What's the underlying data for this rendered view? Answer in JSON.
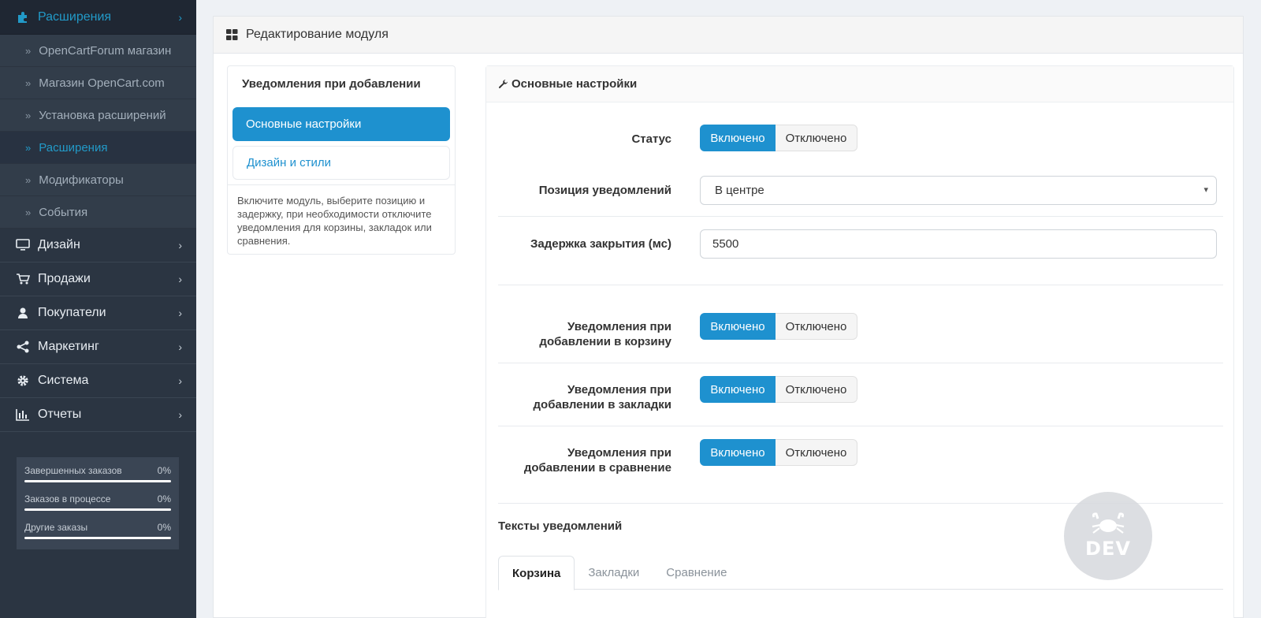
{
  "sidebar": {
    "top_item": {
      "label": "Расширения",
      "icon": "puzzle-icon"
    },
    "sub_items": [
      {
        "label": "OpenCartForum магазин",
        "active": false
      },
      {
        "label": "Магазин OpenCart.com",
        "active": false
      },
      {
        "label": "Установка расширений",
        "active": false
      },
      {
        "label": "Расширения",
        "active": true
      },
      {
        "label": "Модификаторы",
        "active": false
      },
      {
        "label": "События",
        "active": false
      }
    ],
    "items": [
      {
        "label": "Дизайн",
        "icon": "monitor-icon"
      },
      {
        "label": "Продажи",
        "icon": "cart-icon"
      },
      {
        "label": "Покупатели",
        "icon": "user-icon"
      },
      {
        "label": "Маркетинг",
        "icon": "share-icon"
      },
      {
        "label": "Система",
        "icon": "gear-icon"
      },
      {
        "label": "Отчеты",
        "icon": "bar-chart-icon"
      }
    ],
    "stats": [
      {
        "label": "Завершенных заказов",
        "value": "0%"
      },
      {
        "label": "Заказов в процессе",
        "value": "0%"
      },
      {
        "label": "Другие заказы",
        "value": "0%"
      }
    ]
  },
  "panel": {
    "title": "Редактирование модуля",
    "icon": "grid-icon"
  },
  "left_menu": {
    "title": "Уведомления при добавлении",
    "items": [
      {
        "label": "Основные настройки",
        "active": true
      },
      {
        "label": "Дизайн и стили",
        "active": false
      }
    ],
    "description": "Включите модуль, выберите позицию и задержку, при необходимости отключите уведомления для корзины, закладок или сравнения."
  },
  "settings": {
    "header": "Основные настройки",
    "header_icon": "wrench-icon",
    "status_label": "Статус",
    "on_label": "Включено",
    "off_label": "Отключено",
    "position_label": "Позиция уведомлений",
    "position_value": "В центре",
    "delay_label": "Задержка закрытия (мс)",
    "delay_value": "5500",
    "cart_label_1": "Уведомления при",
    "cart_label_2": "добавлении в корзину",
    "wishlist_label_1": "Уведомления при",
    "wishlist_label_2": "добавлении в закладки",
    "compare_label_1": "Уведомления при",
    "compare_label_2": "добавлении в сравнение",
    "texts_title": "Тексты уведомлений",
    "tabs": [
      {
        "label": "Корзина",
        "active": true
      },
      {
        "label": "Закладки",
        "active": false
      },
      {
        "label": "Сравнение",
        "active": false
      }
    ]
  },
  "watermark": {
    "text": "DEV"
  },
  "colors": {
    "accent": "#1e91cf",
    "sidebar_bg": "#2b3542",
    "sidebar_active": "#229ac8"
  }
}
